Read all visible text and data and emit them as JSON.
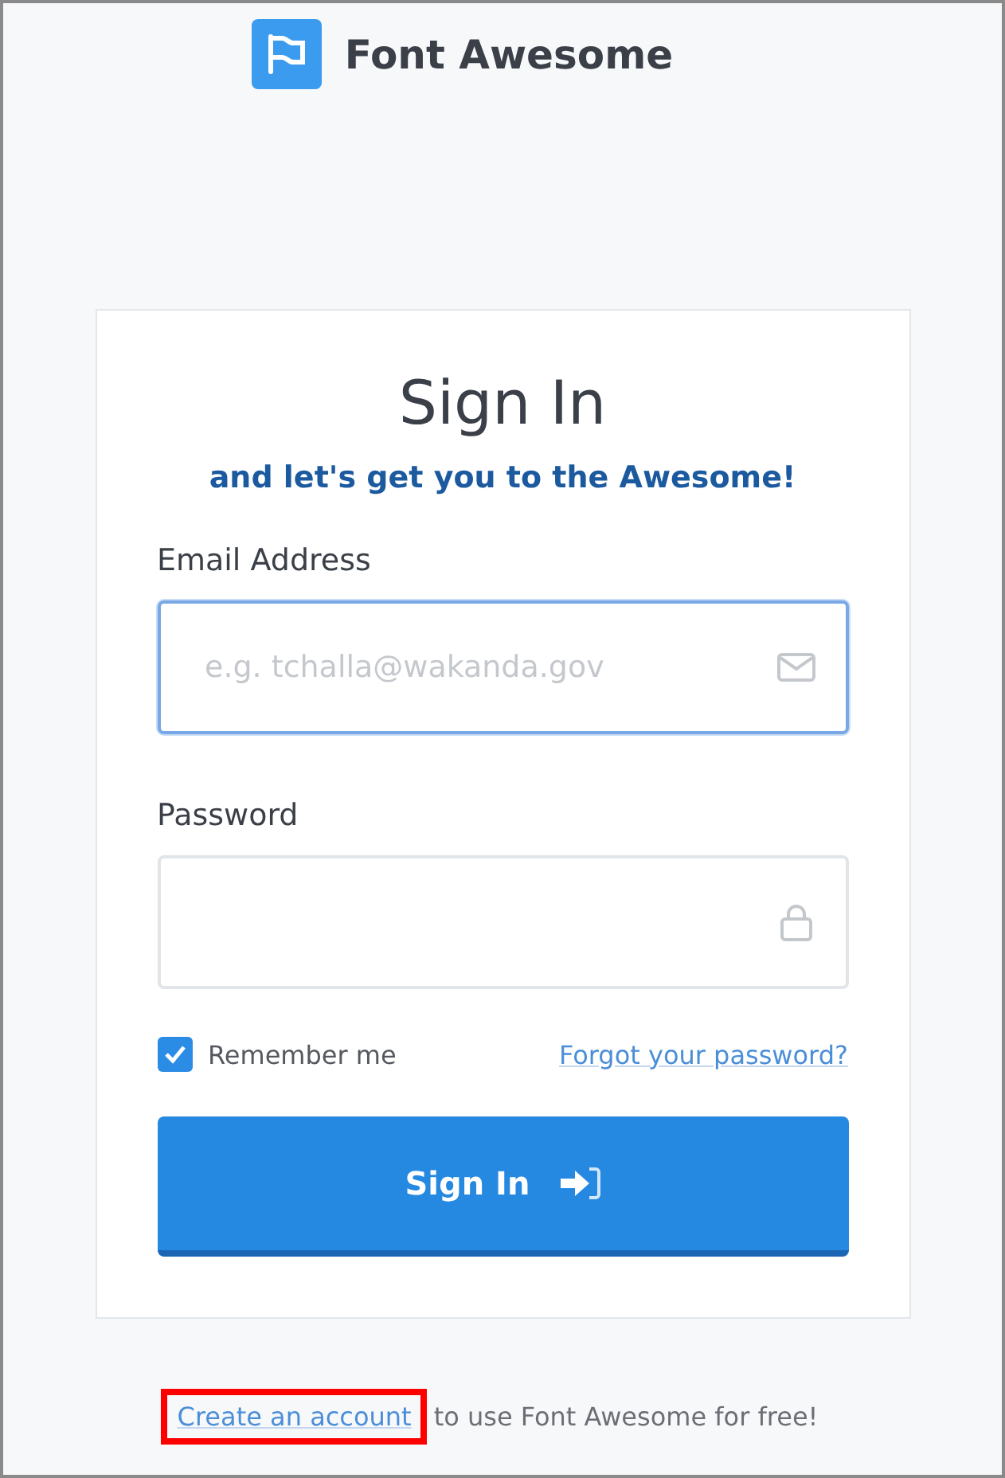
{
  "brand": {
    "name": "Font Awesome"
  },
  "card": {
    "title": "Sign In",
    "subtitle": "and let's get you to the Awesome!",
    "fields": [
      {
        "label": "Email Address",
        "placeholder": "e.g. tchalla@wakanda.gov",
        "kind": "email",
        "focused": true
      },
      {
        "label": "Password",
        "kind": "password",
        "focused": false
      }
    ],
    "remember": {
      "label": "Remember me",
      "checked": true
    },
    "forgot_link": "Forgot your password?",
    "submit": "Sign In"
  },
  "footer": {
    "link": "Create an account",
    "text": "to use Font Awesome for free!",
    "link_highlighted": true
  }
}
